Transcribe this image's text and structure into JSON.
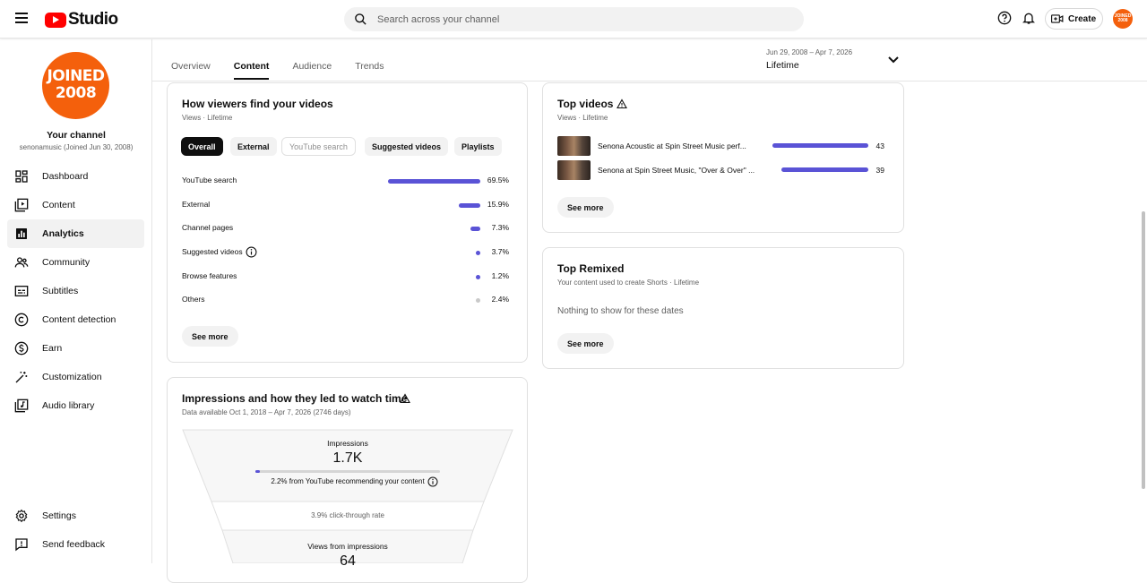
{
  "app": {
    "logo_text": "Studio"
  },
  "search": {
    "placeholder": "Search across your channel"
  },
  "header": {
    "create_label": "Create",
    "avatar_text": "JOINED 2008"
  },
  "channel": {
    "avatar_line1": "JOINED",
    "avatar_line2": "2008",
    "name": "Your channel",
    "sub": "senonamusic (Joined Jun 30, 2008)"
  },
  "sidebar": {
    "items": [
      {
        "label": "Dashboard",
        "icon": "dashboard-icon"
      },
      {
        "label": "Content",
        "icon": "content-icon"
      },
      {
        "label": "Analytics",
        "icon": "analytics-icon",
        "active": true
      },
      {
        "label": "Community",
        "icon": "community-icon"
      },
      {
        "label": "Subtitles",
        "icon": "subtitles-icon"
      },
      {
        "label": "Content detection",
        "icon": "copyright-icon"
      },
      {
        "label": "Earn",
        "icon": "dollar-icon"
      },
      {
        "label": "Customization",
        "icon": "wand-icon"
      },
      {
        "label": "Audio library",
        "icon": "audio-library-icon"
      }
    ],
    "bottom": [
      {
        "label": "Settings",
        "icon": "gear-icon"
      },
      {
        "label": "Send feedback",
        "icon": "feedback-icon"
      }
    ]
  },
  "tabs": [
    "Overview",
    "Content",
    "Audience",
    "Trends"
  ],
  "active_tab": "Content",
  "date_range": {
    "range": "Jun 29, 2008 – Apr 7, 2026",
    "label": "Lifetime"
  },
  "traffic_sources": {
    "title": "How viewers find your videos",
    "subtitle": "Views · Lifetime",
    "chips": [
      "Overall",
      "External",
      "YouTube search",
      "Suggested videos",
      "Playlists"
    ],
    "rows": [
      {
        "label": "YouTube search",
        "value": "69.5%",
        "pct": 69.5
      },
      {
        "label": "External",
        "value": "15.9%",
        "pct": 15.9
      },
      {
        "label": "Channel pages",
        "value": "7.3%",
        "pct": 7.3
      },
      {
        "label": "Suggested videos",
        "value": "3.7%",
        "pct": 3.7
      },
      {
        "label": "Browse features",
        "value": "1.2%",
        "pct": 1.2
      },
      {
        "label": "Others",
        "value": "2.4%",
        "pct": 2.4
      }
    ],
    "see_more": "See more"
  },
  "top_videos": {
    "title": "Top videos",
    "subtitle": "Views · Lifetime",
    "rows": [
      {
        "title": "Senona Acoustic at Spin Street Music perf...",
        "views": "43",
        "value": 43
      },
      {
        "title": "Senona at Spin Street Music, \"Over & Over\" ...",
        "views": "39",
        "value": 39
      }
    ],
    "see_more": "See more"
  },
  "top_remixed": {
    "title": "Top Remixed",
    "subtitle": "Your content used to create Shorts · Lifetime",
    "empty": "Nothing to show for these dates",
    "see_more": "See more"
  },
  "impressions": {
    "title": "Impressions and how they led to watch time",
    "subtitle": "Data available Oct 1, 2018 – Apr 7, 2026 (2746 days)",
    "impressions_label": "Impressions",
    "impressions_value": "1.7K",
    "recommend_text": "2.2% from YouTube recommending your content",
    "recommend_pct": 2.2,
    "ctr_text": "3.9% click-through rate",
    "views_label": "Views from impressions",
    "views_value": "64"
  },
  "colors": {
    "accent": "#5a53d6",
    "brand": "#ff0000",
    "avatar": "#f4600c"
  }
}
